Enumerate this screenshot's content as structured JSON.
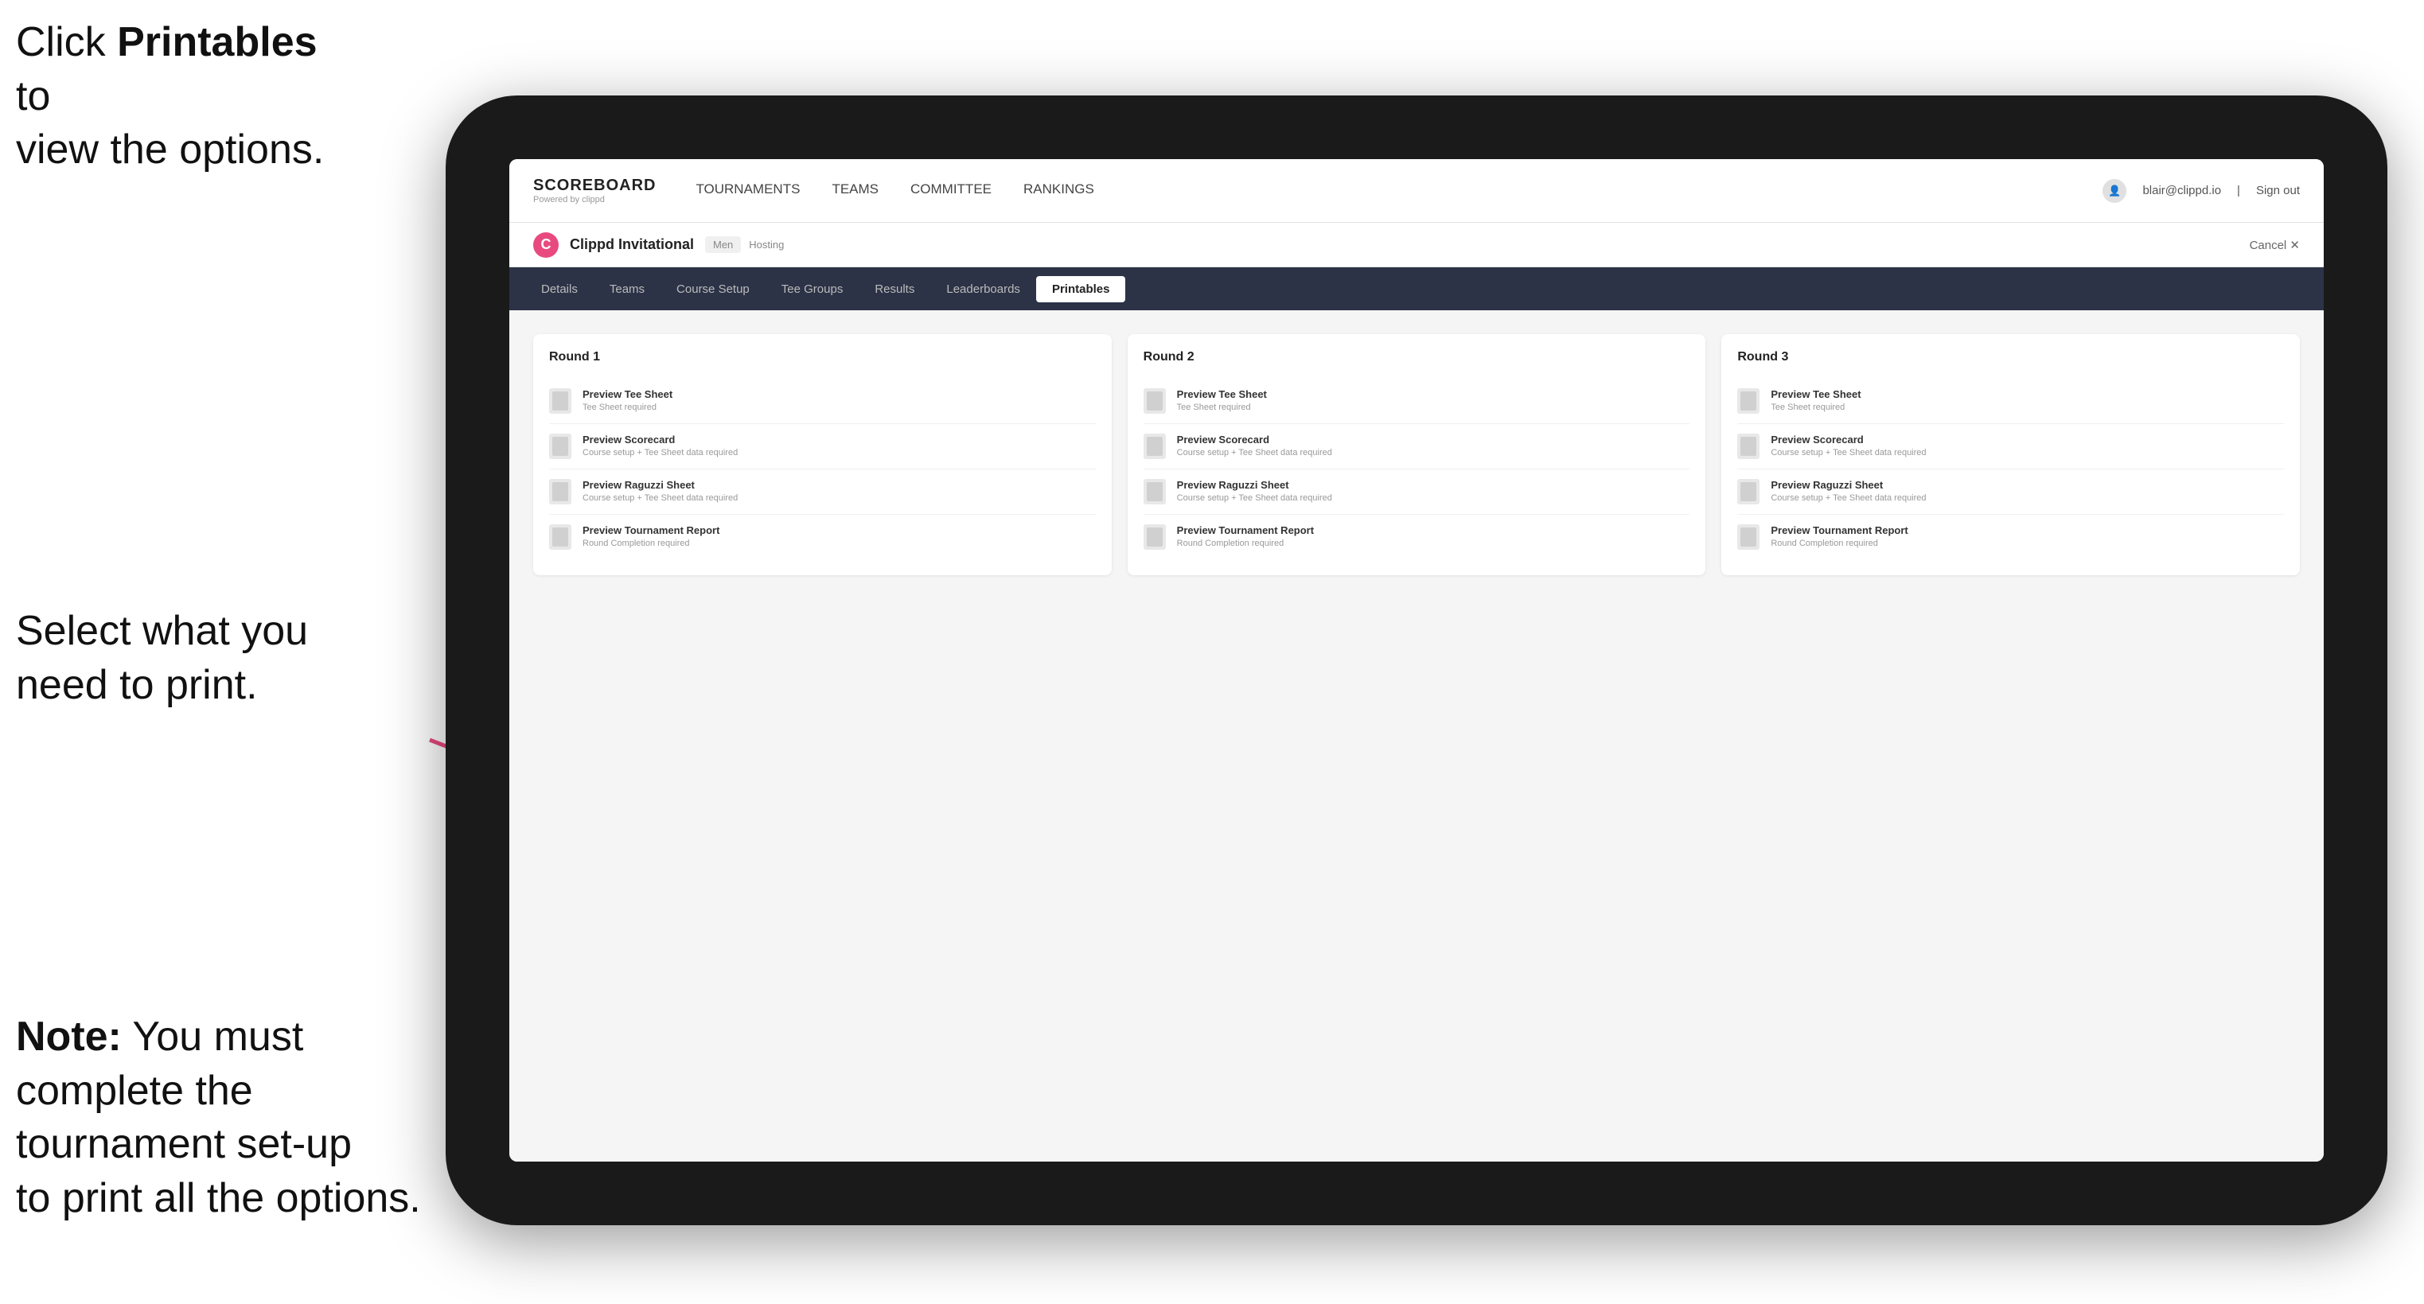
{
  "annotations": {
    "top": {
      "text_part1": "Click ",
      "text_bold": "Printables",
      "text_part2": " to view the options."
    },
    "mid": {
      "text": "Select what you need to print."
    },
    "bottom": {
      "text_bold": "Note:",
      "text": " You must complete the tournament set-up to print all the options."
    }
  },
  "nav": {
    "logo_title": "SCOREBOARD",
    "logo_sub": "Powered by clippd",
    "links": [
      "TOURNAMENTS",
      "TEAMS",
      "COMMITTEE",
      "RANKINGS"
    ],
    "active_link": "TOURNAMENTS",
    "user_email": "blair@clippd.io",
    "sign_out": "Sign out"
  },
  "tournament_header": {
    "logo_letter": "C",
    "name": "Clippd Invitational",
    "badge": "Men",
    "status": "Hosting",
    "cancel": "Cancel ✕"
  },
  "sub_tabs": {
    "tabs": [
      "Details",
      "Teams",
      "Course Setup",
      "Tee Groups",
      "Results",
      "Leaderboards",
      "Printables"
    ],
    "active_tab": "Printables"
  },
  "rounds": [
    {
      "title": "Round 1",
      "items": [
        {
          "title": "Preview Tee Sheet",
          "sub": "Tee Sheet required"
        },
        {
          "title": "Preview Scorecard",
          "sub": "Course setup + Tee Sheet data required"
        },
        {
          "title": "Preview Raguzzi Sheet",
          "sub": "Course setup + Tee Sheet data required"
        },
        {
          "title": "Preview Tournament Report",
          "sub": "Round Completion required"
        }
      ]
    },
    {
      "title": "Round 2",
      "items": [
        {
          "title": "Preview Tee Sheet",
          "sub": "Tee Sheet required"
        },
        {
          "title": "Preview Scorecard",
          "sub": "Course setup + Tee Sheet data required"
        },
        {
          "title": "Preview Raguzzi Sheet",
          "sub": "Course setup + Tee Sheet data required"
        },
        {
          "title": "Preview Tournament Report",
          "sub": "Round Completion required"
        }
      ]
    },
    {
      "title": "Round 3",
      "items": [
        {
          "title": "Preview Tee Sheet",
          "sub": "Tee Sheet required"
        },
        {
          "title": "Preview Scorecard",
          "sub": "Course setup + Tee Sheet data required"
        },
        {
          "title": "Preview Raguzzi Sheet",
          "sub": "Course setup + Tee Sheet data required"
        },
        {
          "title": "Preview Tournament Report",
          "sub": "Round Completion required"
        }
      ]
    }
  ]
}
